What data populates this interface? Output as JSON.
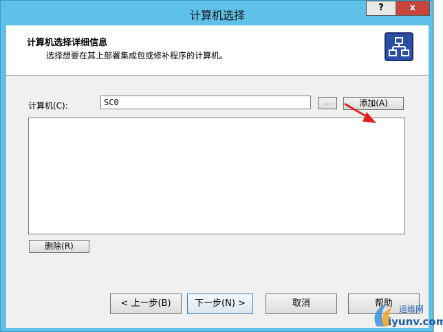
{
  "window": {
    "title": "计算机选择",
    "help_button": "?",
    "close_button": "x"
  },
  "header": {
    "title": "计算机选择详细信息",
    "subtitle": "选择想要在其上部署集成包或修补程序的计算机。",
    "icon": "network-topology-icon"
  },
  "form": {
    "computer_label": "计算机(C):",
    "computer_value": "SC0",
    "browse_button": "...",
    "add_button": "添加(A)",
    "remove_button": "删除(R)"
  },
  "footer": {
    "back_button": "< 上一步(B)",
    "next_button": "下一步(N) >",
    "cancel_button": "取消",
    "help_button": "帮助"
  },
  "watermark": {
    "top_text": "运维网",
    "bottom_text": "iyunv.com"
  },
  "colors": {
    "titlebar": "#5fc0e8",
    "close_button": "#c9443a",
    "annotation_arrow": "#e02020",
    "icon_blue": "#2a4fa6"
  }
}
